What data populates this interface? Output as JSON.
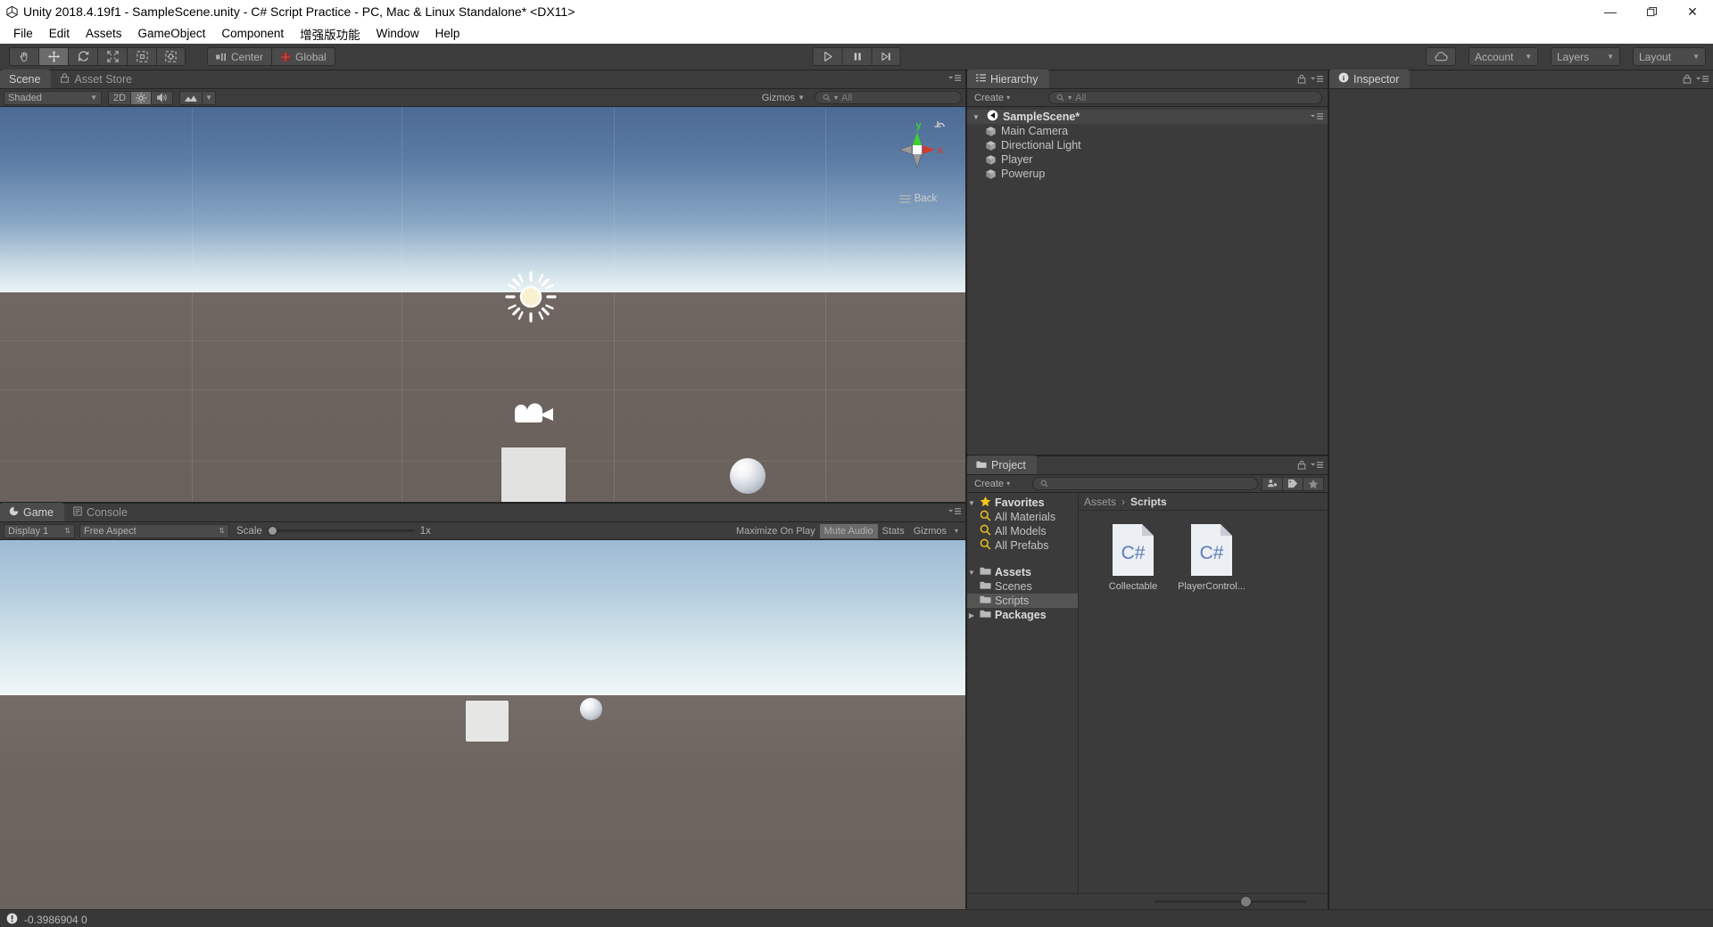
{
  "window": {
    "title": "Unity 2018.4.19f1 - SampleScene.unity - C# Script Practice - PC, Mac & Linux Standalone* <DX11>",
    "minimize_label": "—",
    "maximize_label": "❐",
    "close_label": "✕",
    "logo_icon": "unity-logo-icon"
  },
  "menubar": {
    "items": [
      {
        "label": "File"
      },
      {
        "label": "Edit"
      },
      {
        "label": "Assets"
      },
      {
        "label": "GameObject"
      },
      {
        "label": "Component"
      },
      {
        "label": "增强版功能"
      },
      {
        "label": "Window"
      },
      {
        "label": "Help"
      }
    ]
  },
  "toolbar": {
    "tools": [
      {
        "name": "hand-tool",
        "active": false
      },
      {
        "name": "move-tool",
        "active": true
      },
      {
        "name": "rotate-tool",
        "active": false
      },
      {
        "name": "scale-tool",
        "active": false
      },
      {
        "name": "rect-tool",
        "active": false
      },
      {
        "name": "transform-tool",
        "active": false
      }
    ],
    "pivot_label": "Center",
    "space_label": "Global",
    "play_label": "Play",
    "pause_label": "Pause",
    "step_label": "Step",
    "cloud_label": "Collab",
    "account_label": "Account",
    "layers_label": "Layers",
    "layout_label": "Layout"
  },
  "scene_panel": {
    "tabs": [
      {
        "label": "Scene",
        "active": true,
        "icon": "scene-icon"
      },
      {
        "label": "Asset Store",
        "active": false,
        "icon": "store-icon"
      }
    ],
    "draw_mode": "Shaded",
    "toggle_2d": "2D",
    "lighting_icon": "lighting-icon",
    "audio_icon": "audio-icon",
    "effects_icon": "effects-icon",
    "gizmos_label": "Gizmos",
    "search_placeholder": "All",
    "search_value": "",
    "gizmo": {
      "axis_y": "y",
      "axis_x": "x",
      "view_label": "Back"
    }
  },
  "game_panel": {
    "tabs": [
      {
        "label": "Game",
        "active": true,
        "icon": "game-icon"
      },
      {
        "label": "Console",
        "active": false,
        "icon": "console-icon"
      }
    ],
    "display_label": "Display 1",
    "aspect_label": "Free Aspect",
    "scale_label": "Scale",
    "scale_value": "1x",
    "maximize_label": "Maximize On Play",
    "mute_label": "Mute Audio",
    "stats_label": "Stats",
    "gizmos_label": "Gizmos"
  },
  "hierarchy": {
    "tab_label": "Hierarchy",
    "create_label": "Create",
    "search_placeholder": "All",
    "search_value": "",
    "scene_name": "SampleScene*",
    "items": [
      {
        "label": "Main Camera"
      },
      {
        "label": "Directional Light"
      },
      {
        "label": "Player"
      },
      {
        "label": "Powerup"
      }
    ]
  },
  "project": {
    "tab_label": "Project",
    "create_label": "Create",
    "search_placeholder": "",
    "search_value": "",
    "tree": [
      {
        "label": "Favorites",
        "type": "root",
        "indent": 0,
        "expanded": true,
        "icon": "star-icon",
        "selected": false
      },
      {
        "label": "All Materials",
        "type": "search",
        "indent": 1,
        "icon": "search-icon",
        "selected": false
      },
      {
        "label": "All Models",
        "type": "search",
        "indent": 1,
        "icon": "search-icon",
        "selected": false
      },
      {
        "label": "All Prefabs",
        "type": "search",
        "indent": 1,
        "icon": "search-icon",
        "selected": false
      },
      {
        "label": "Assets",
        "type": "root",
        "indent": 0,
        "expanded": true,
        "icon": "folder-icon",
        "selected": false
      },
      {
        "label": "Scenes",
        "type": "folder",
        "indent": 1,
        "icon": "folder-icon",
        "selected": false
      },
      {
        "label": "Scripts",
        "type": "folder",
        "indent": 1,
        "icon": "folder-icon",
        "selected": true
      },
      {
        "label": "Packages",
        "type": "root",
        "indent": 0,
        "expanded": false,
        "icon": "folder-icon",
        "selected": false
      }
    ],
    "breadcrumb": [
      {
        "label": "Assets",
        "current": false
      },
      {
        "label": "Scripts",
        "current": true
      }
    ],
    "breadcrumb_sep": "›",
    "assets": [
      {
        "label": "Collectable",
        "type": "csharp-script",
        "badge": "C#"
      },
      {
        "label": "PlayerControl...",
        "type": "csharp-script",
        "badge": "C#"
      }
    ]
  },
  "inspector": {
    "tab_label": "Inspector",
    "icon": "info-icon"
  },
  "statusbar": {
    "icon": "error-icon",
    "message": "-0.3986904 0"
  },
  "colors": {
    "panel_bg": "#3b3b3b",
    "toolbar_bg": "#3c3c3c",
    "tab_active": "#4b4b4b",
    "selection": "#545454",
    "text": "#c4c4c4",
    "axis_x": "#d23c2e",
    "axis_y": "#3dd42a",
    "star_yellow": "#f5c518",
    "csharp_blue": "#5d7cba"
  }
}
